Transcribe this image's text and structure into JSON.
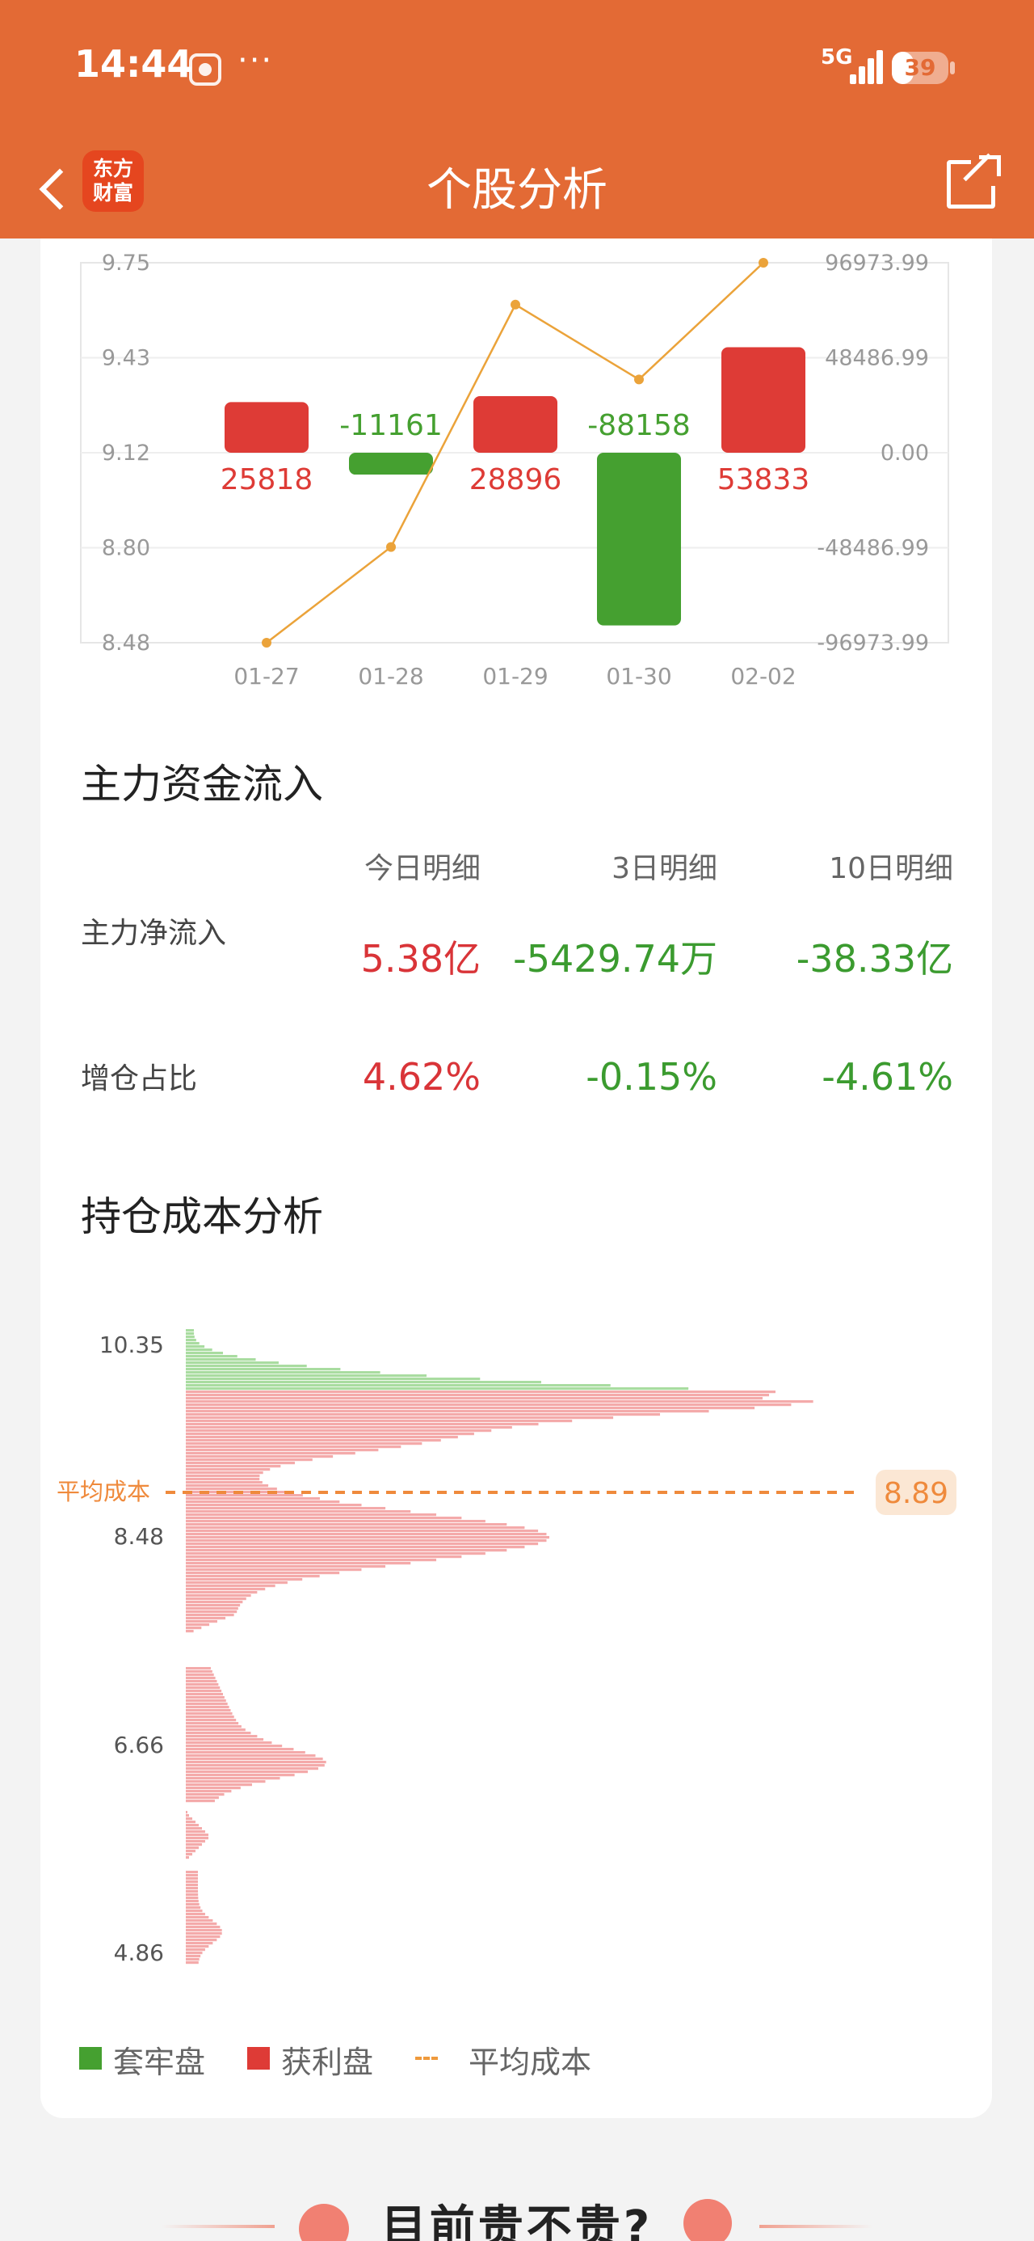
{
  "status_bar": {
    "time": "14:44",
    "more_dots": "···",
    "network": "5G",
    "battery": "39",
    "battery_level": 0.39
  },
  "nav": {
    "title": "个股分析",
    "logo_line1": "东方",
    "logo_line2": "财富"
  },
  "flow_chart": {
    "type": "bar",
    "categories": [
      "01-27",
      "01-28",
      "01-29",
      "01-30",
      "02-02"
    ],
    "bar_values": [
      25818,
      -11161,
      28896,
      -88158,
      53833
    ],
    "bar_labels": [
      "25818",
      "-11161",
      "28896",
      "-88158",
      "53833"
    ],
    "line_values": [
      8.48,
      8.8,
      9.61,
      9.36,
      9.75
    ],
    "left_axis": [
      "9.75",
      "9.43",
      "9.12",
      "8.80",
      "8.48"
    ],
    "left_range": [
      8.48,
      9.75
    ],
    "right_axis": [
      "96973.99",
      "48486.99",
      "0.00",
      "-48486.99",
      "-96973.99"
    ],
    "right_range": [
      -96973.99,
      96973.99
    ],
    "colors": {
      "positive": "#de3b36",
      "negative": "#45a030",
      "line": "#eba33a"
    }
  },
  "main_flow": {
    "title": "主力资金流入",
    "headers": [
      "今日明细",
      "3日明细",
      "10日明细"
    ],
    "rows": [
      {
        "label": "主力净流入",
        "values": [
          "5.38亿",
          "-5429.74万",
          "-38.33亿"
        ],
        "colors": [
          "red",
          "green",
          "green"
        ]
      },
      {
        "label": "增仓占比",
        "values": [
          "4.62%",
          "-0.15%",
          "-4.61%"
        ],
        "colors": [
          "red",
          "green",
          "green"
        ]
      }
    ]
  },
  "cost_analysis": {
    "title": "持仓成本分析",
    "price_ticks": [
      "10.35",
      "8.48",
      "6.66",
      "4.86"
    ],
    "avg_cost_label": "平均成本",
    "avg_cost_value": "8.89",
    "colors": {
      "trapped": "#a9dca0",
      "profit": "#f4aaaa",
      "avg": "#ef8a3c"
    }
  },
  "legend": [
    {
      "label": "套牢盘",
      "color": "#45a030"
    },
    {
      "label": "获利盘",
      "color": "#de3b36"
    },
    {
      "label": "平均成本",
      "color": "#ef9a3c"
    }
  ],
  "footer": {
    "title": "目前贵不贵?"
  }
}
